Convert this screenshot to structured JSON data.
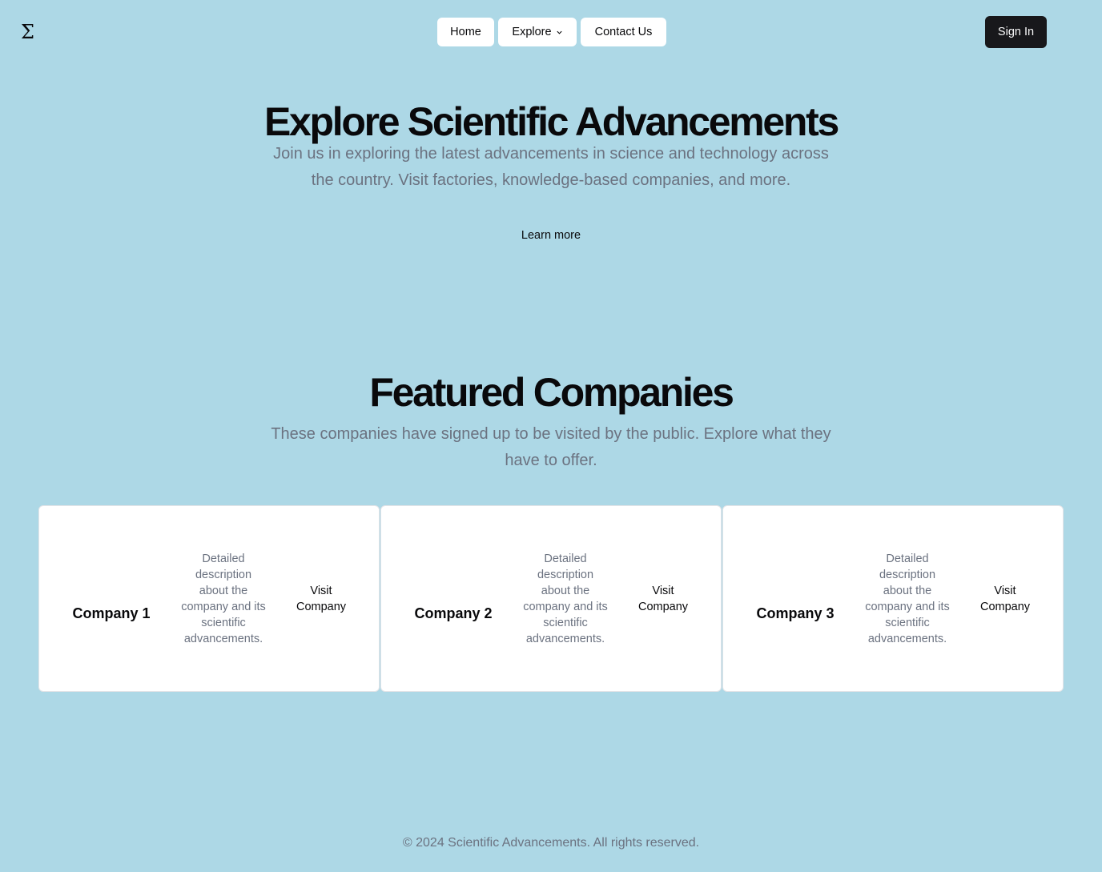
{
  "header": {
    "logo_glyph": "Σ",
    "nav": {
      "home": "Home",
      "explore": "Explore",
      "contact": "Contact Us"
    },
    "sign_in": "Sign In"
  },
  "hero": {
    "title": "Explore Scientific Advancements",
    "subtitle": "Join us in exploring the latest advancements in science and technology across the country. Visit factories, knowledge-based companies, and more.",
    "learn_more": "Learn more"
  },
  "featured": {
    "title": "Featured Companies",
    "subtitle": "These companies have signed up to be visited by the public. Explore what they have to offer.",
    "companies": [
      {
        "name": "Company 1",
        "description": "Detailed description about the company and its scientific advancements.",
        "action": "Visit Company"
      },
      {
        "name": "Company 2",
        "description": "Detailed description about the company and its scientific advancements.",
        "action": "Visit Company"
      },
      {
        "name": "Company 3",
        "description": "Detailed description about the company and its scientific advancements.",
        "action": "Visit Company"
      }
    ]
  },
  "footer": {
    "text": "© 2024 Scientific Advancements. All rights reserved."
  },
  "colors": {
    "background": "#add8e6",
    "primary": "#18181b",
    "muted_text": "#6b7280",
    "card": "#ffffff"
  }
}
